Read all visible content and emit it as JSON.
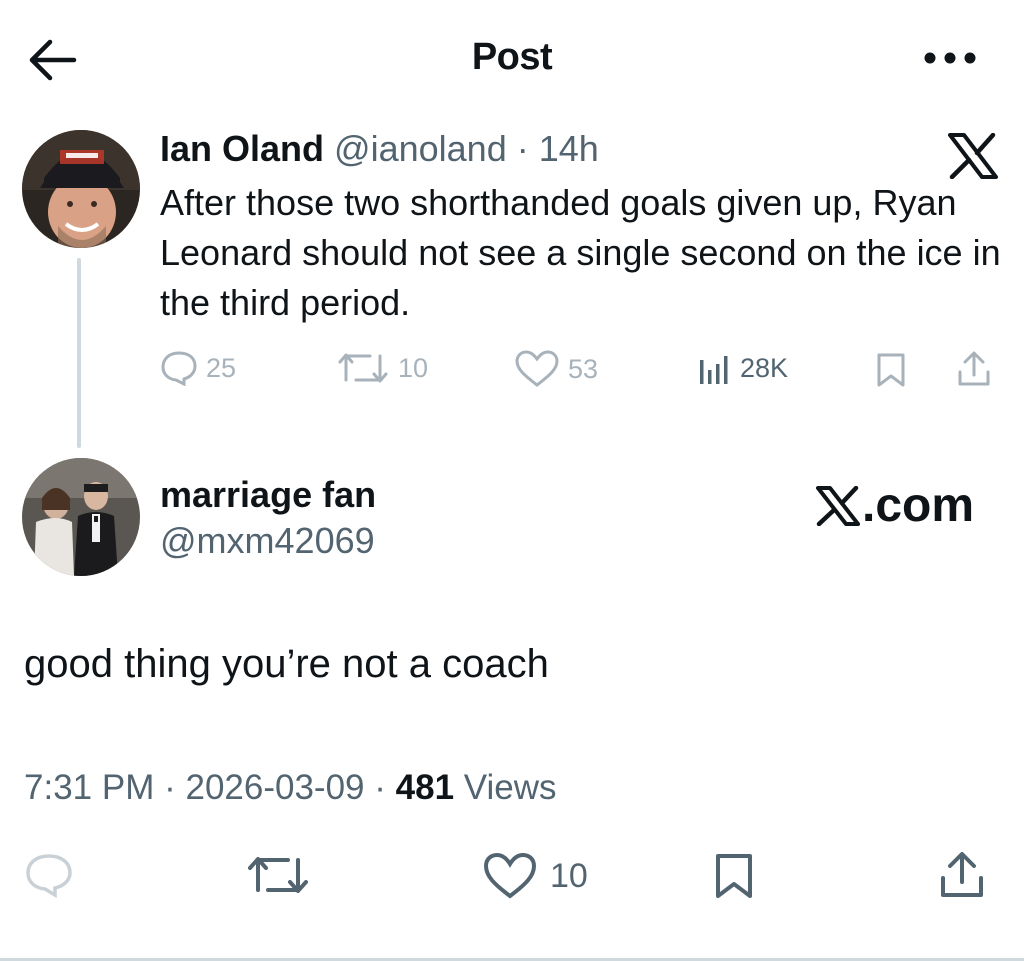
{
  "header": {
    "title": "Post",
    "back_icon": "arrow-left-icon",
    "more_icon": "more-horizontal-icon"
  },
  "parent_post": {
    "author_name": "Ian Oland",
    "handle": "@ianoland",
    "separator": "·",
    "time": "14h",
    "text": "After those two shorthanded goals given up, Ryan Leonard should not see a single second on the ice in the third period.",
    "stats": {
      "replies": "25",
      "reposts": "10",
      "likes": "53",
      "views": "28K"
    },
    "brand_icon": "x-logo-icon"
  },
  "reply_post": {
    "author_name": "marriage fan",
    "handle": "@mxm42069",
    "brand_label": ".com",
    "text": "good thing you’re not a coach",
    "time": "7:31 PM",
    "separator": "·",
    "date": "2026-03-09",
    "views_count": "481",
    "views_label": "Views",
    "likes": "10"
  },
  "colors": {
    "text": "#0f1419",
    "secondary": "#536471",
    "muted": "#a8b2ba",
    "divider": "#cfd9de"
  }
}
